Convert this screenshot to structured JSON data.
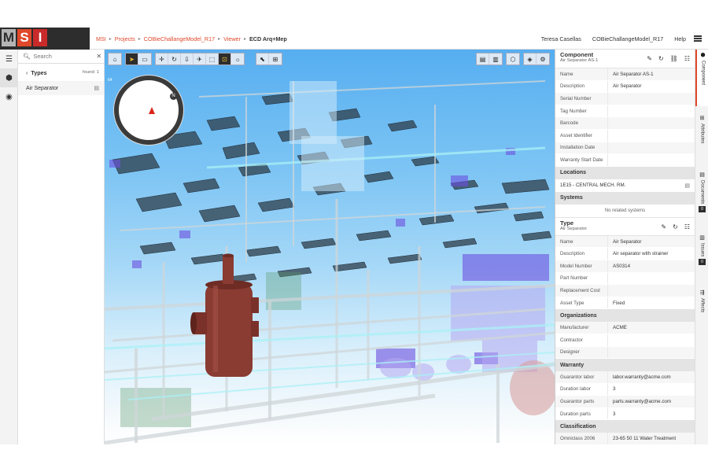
{
  "header": {
    "logo_letters": [
      "M",
      "S",
      "I"
    ],
    "logo_colors": [
      "#b5b5b5",
      "#e0482a",
      "#c92a2a"
    ],
    "breadcrumbs": [
      "MSI",
      "Projects",
      "COBieChallangeModel_R17",
      "Viewer"
    ],
    "current": "ECD Arq+Mep",
    "user": "Teresa Casellas",
    "project": "COBieChallangeModel_R17",
    "help": "Help"
  },
  "tree": {
    "search_placeholder": "Search",
    "types_label": "Types",
    "found": "found: 1",
    "items": [
      "Air Separator"
    ]
  },
  "viewer": {
    "compass_percent": "64",
    "compass_label": "N"
  },
  "component": {
    "heading": "Component",
    "subtitle": "Air Separator AS-1",
    "rows": [
      {
        "k": "Name",
        "v": "Air Separator AS-1"
      },
      {
        "k": "Description",
        "v": "Air Separator"
      },
      {
        "k": "Serial Number",
        "v": ""
      },
      {
        "k": "Tag Number",
        "v": ""
      },
      {
        "k": "Barcode",
        "v": ""
      },
      {
        "k": "Asset Identifier",
        "v": ""
      },
      {
        "k": "Installation Date",
        "v": ""
      },
      {
        "k": "Warranty Start Date",
        "v": ""
      }
    ]
  },
  "locations": {
    "heading": "Locations",
    "value": "1E15 - CENTRAL MECH. RM."
  },
  "systems": {
    "heading": "Systems",
    "empty": "No related systems"
  },
  "type": {
    "heading": "Type",
    "subtitle": "Air Separator",
    "rows": [
      {
        "k": "Name",
        "v": "Air Separator"
      },
      {
        "k": "Description",
        "v": "Air separator with strainer"
      },
      {
        "k": "Model Number",
        "v": "AS0314"
      },
      {
        "k": "Part Number",
        "v": ""
      },
      {
        "k": "Replacement Cost",
        "v": ""
      },
      {
        "k": "Asset Type",
        "v": "Fixed"
      }
    ]
  },
  "organizations": {
    "heading": "Organizations",
    "rows": [
      {
        "k": "Manufacturer",
        "v": "ACME"
      },
      {
        "k": "Contractor",
        "v": ""
      },
      {
        "k": "Designer",
        "v": ""
      }
    ]
  },
  "warranty": {
    "heading": "Warranty",
    "rows": [
      {
        "k": "Guarantor labor",
        "v": "labor.warranty@acme.com"
      },
      {
        "k": "Duration labor",
        "v": "3"
      },
      {
        "k": "Guarantor parts",
        "v": "parts.warranty@acme.com"
      },
      {
        "k": "Duration parts",
        "v": "3"
      }
    ]
  },
  "classification": {
    "heading": "Classification",
    "rows": [
      {
        "k": "Omniclass 2006",
        "v": "23-65 50 11 Water Treatment"
      }
    ]
  },
  "tabs": {
    "component": "Component",
    "attributes": "Attributes",
    "documents": "Documents",
    "documents_count": "0",
    "issues": "Issues",
    "issues_count": "0",
    "affects": "Affects"
  }
}
